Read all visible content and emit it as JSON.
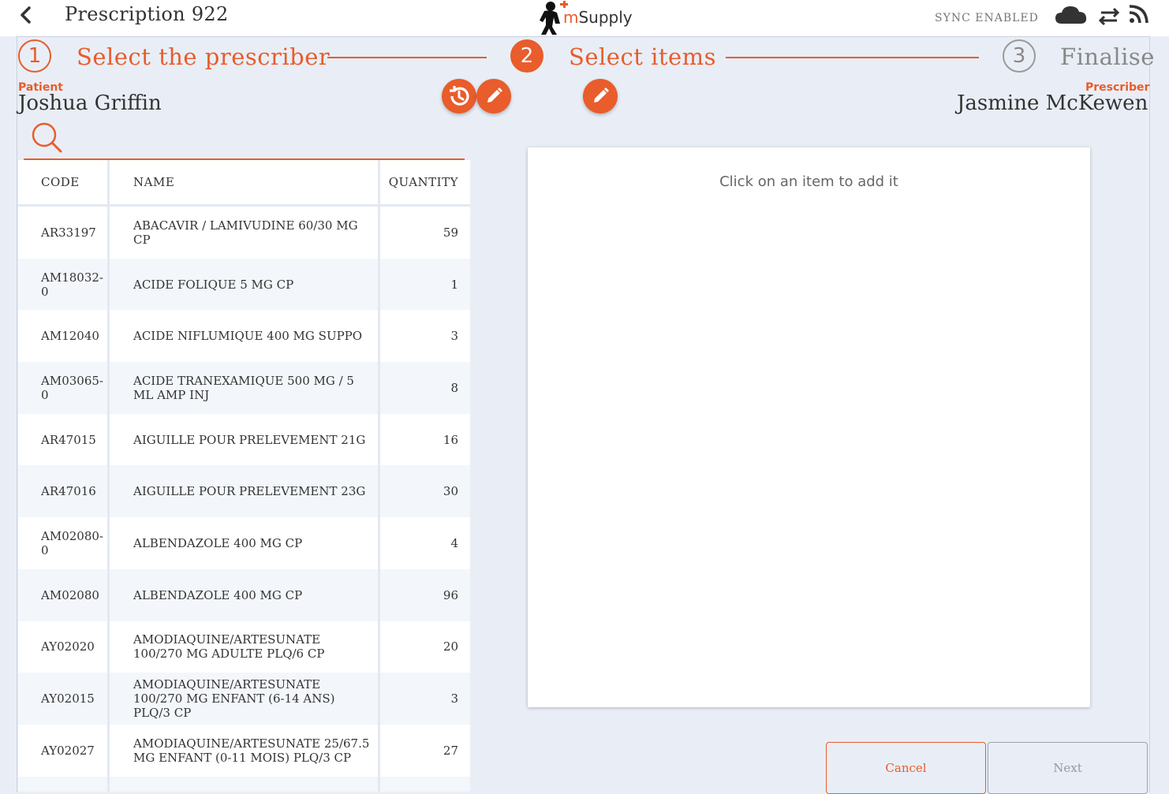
{
  "header": {
    "title": "Prescription 922",
    "back_icon": "chevron-left-icon",
    "logo_m": "m",
    "logo_rest": "Supply",
    "sync_status": "SYNC ENABLED",
    "icons": [
      "cloud-icon",
      "sync-arrows-icon",
      "rss-feed-icon"
    ]
  },
  "steps": [
    {
      "number": "1",
      "label": "Select the prescriber",
      "state": "completed"
    },
    {
      "number": "2",
      "label": "Select items",
      "state": "active"
    },
    {
      "number": "3",
      "label": "Finalise",
      "state": "inactive"
    }
  ],
  "patient": {
    "label": "Patient",
    "name": "Joshua Griffin"
  },
  "prescriber": {
    "label": "Prescriber",
    "name": "Jasmine McKewen"
  },
  "action_icons": [
    "history-icon",
    "pencil-icon",
    "pencil-icon"
  ],
  "table": {
    "headers": {
      "code": "CODE",
      "name": "NAME",
      "quantity": "QUANTITY"
    },
    "rows": [
      {
        "code": "AR33197",
        "name": "ABACAVIR / LAMIVUDINE 60/30 MG CP",
        "quantity": "59"
      },
      {
        "code": "AM18032-0",
        "name": "ACIDE FOLIQUE 5 MG CP",
        "quantity": "1"
      },
      {
        "code": "AM12040",
        "name": "ACIDE NIFLUMIQUE 400 MG SUPPO",
        "quantity": "3"
      },
      {
        "code": "AM03065-0",
        "name": "ACIDE TRANEXAMIQUE 500 MG / 5 ML AMP INJ",
        "quantity": "8"
      },
      {
        "code": "AR47015",
        "name": "AIGUILLE POUR PRELEVEMENT  21G",
        "quantity": "16"
      },
      {
        "code": "AR47016",
        "name": "AIGUILLE POUR PRELEVEMENT 23G",
        "quantity": "30"
      },
      {
        "code": "AM02080-0",
        "name": "ALBENDAZOLE 400 MG CP",
        "quantity": "4"
      },
      {
        "code": "AM02080",
        "name": "ALBENDAZOLE 400 MG CP",
        "quantity": "96"
      },
      {
        "code": "AY02020",
        "name": "AMODIAQUINE/ARTESUNATE 100/270 MG ADULTE PLQ/6 CP",
        "quantity": "20"
      },
      {
        "code": "AY02015",
        "name": "AMODIAQUINE/ARTESUNATE 100/270 MG ENFANT (6-14 ANS)  PLQ/3 CP",
        "quantity": "3"
      },
      {
        "code": "AY02027",
        "name": "AMODIAQUINE/ARTESUNATE 25/67.5 MG ENFANT (0-11 MOIS) PLQ/3 CP",
        "quantity": "27"
      }
    ]
  },
  "items_panel": {
    "hint": "Click on an item to add it"
  },
  "footer": {
    "cancel_label": "Cancel",
    "next_label": "Next"
  },
  "colors": {
    "accent": "#e95c2b",
    "background": "#e9eef6",
    "inactive": "#888888"
  }
}
